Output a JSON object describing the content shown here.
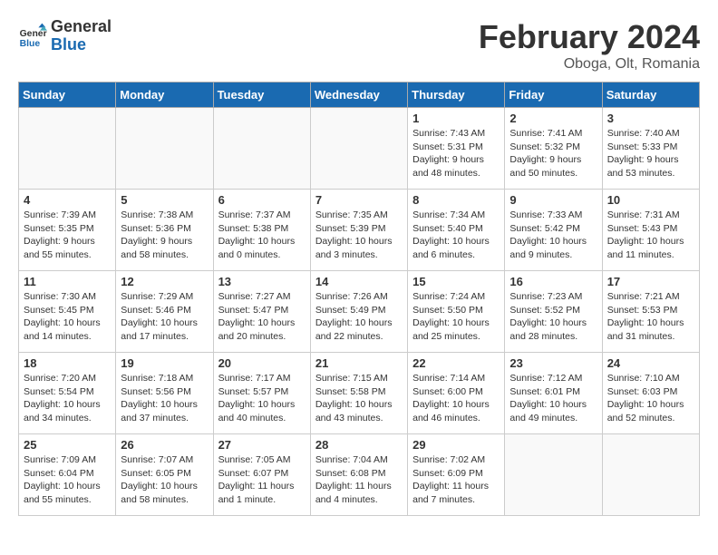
{
  "header": {
    "logo_general": "General",
    "logo_blue": "Blue",
    "month_year": "February 2024",
    "location": "Oboga, Olt, Romania"
  },
  "weekdays": [
    "Sunday",
    "Monday",
    "Tuesday",
    "Wednesday",
    "Thursday",
    "Friday",
    "Saturday"
  ],
  "weeks": [
    [
      {
        "day": "",
        "sunrise": "",
        "sunset": "",
        "daylight": ""
      },
      {
        "day": "",
        "sunrise": "",
        "sunset": "",
        "daylight": ""
      },
      {
        "day": "",
        "sunrise": "",
        "sunset": "",
        "daylight": ""
      },
      {
        "day": "",
        "sunrise": "",
        "sunset": "",
        "daylight": ""
      },
      {
        "day": "1",
        "sunrise": "7:43 AM",
        "sunset": "5:31 PM",
        "daylight": "9 hours and 48 minutes."
      },
      {
        "day": "2",
        "sunrise": "7:41 AM",
        "sunset": "5:32 PM",
        "daylight": "9 hours and 50 minutes."
      },
      {
        "day": "3",
        "sunrise": "7:40 AM",
        "sunset": "5:33 PM",
        "daylight": "9 hours and 53 minutes."
      }
    ],
    [
      {
        "day": "4",
        "sunrise": "7:39 AM",
        "sunset": "5:35 PM",
        "daylight": "9 hours and 55 minutes."
      },
      {
        "day": "5",
        "sunrise": "7:38 AM",
        "sunset": "5:36 PM",
        "daylight": "9 hours and 58 minutes."
      },
      {
        "day": "6",
        "sunrise": "7:37 AM",
        "sunset": "5:38 PM",
        "daylight": "10 hours and 0 minutes."
      },
      {
        "day": "7",
        "sunrise": "7:35 AM",
        "sunset": "5:39 PM",
        "daylight": "10 hours and 3 minutes."
      },
      {
        "day": "8",
        "sunrise": "7:34 AM",
        "sunset": "5:40 PM",
        "daylight": "10 hours and 6 minutes."
      },
      {
        "day": "9",
        "sunrise": "7:33 AM",
        "sunset": "5:42 PM",
        "daylight": "10 hours and 9 minutes."
      },
      {
        "day": "10",
        "sunrise": "7:31 AM",
        "sunset": "5:43 PM",
        "daylight": "10 hours and 11 minutes."
      }
    ],
    [
      {
        "day": "11",
        "sunrise": "7:30 AM",
        "sunset": "5:45 PM",
        "daylight": "10 hours and 14 minutes."
      },
      {
        "day": "12",
        "sunrise": "7:29 AM",
        "sunset": "5:46 PM",
        "daylight": "10 hours and 17 minutes."
      },
      {
        "day": "13",
        "sunrise": "7:27 AM",
        "sunset": "5:47 PM",
        "daylight": "10 hours and 20 minutes."
      },
      {
        "day": "14",
        "sunrise": "7:26 AM",
        "sunset": "5:49 PM",
        "daylight": "10 hours and 22 minutes."
      },
      {
        "day": "15",
        "sunrise": "7:24 AM",
        "sunset": "5:50 PM",
        "daylight": "10 hours and 25 minutes."
      },
      {
        "day": "16",
        "sunrise": "7:23 AM",
        "sunset": "5:52 PM",
        "daylight": "10 hours and 28 minutes."
      },
      {
        "day": "17",
        "sunrise": "7:21 AM",
        "sunset": "5:53 PM",
        "daylight": "10 hours and 31 minutes."
      }
    ],
    [
      {
        "day": "18",
        "sunrise": "7:20 AM",
        "sunset": "5:54 PM",
        "daylight": "10 hours and 34 minutes."
      },
      {
        "day": "19",
        "sunrise": "7:18 AM",
        "sunset": "5:56 PM",
        "daylight": "10 hours and 37 minutes."
      },
      {
        "day": "20",
        "sunrise": "7:17 AM",
        "sunset": "5:57 PM",
        "daylight": "10 hours and 40 minutes."
      },
      {
        "day": "21",
        "sunrise": "7:15 AM",
        "sunset": "5:58 PM",
        "daylight": "10 hours and 43 minutes."
      },
      {
        "day": "22",
        "sunrise": "7:14 AM",
        "sunset": "6:00 PM",
        "daylight": "10 hours and 46 minutes."
      },
      {
        "day": "23",
        "sunrise": "7:12 AM",
        "sunset": "6:01 PM",
        "daylight": "10 hours and 49 minutes."
      },
      {
        "day": "24",
        "sunrise": "7:10 AM",
        "sunset": "6:03 PM",
        "daylight": "10 hours and 52 minutes."
      }
    ],
    [
      {
        "day": "25",
        "sunrise": "7:09 AM",
        "sunset": "6:04 PM",
        "daylight": "10 hours and 55 minutes."
      },
      {
        "day": "26",
        "sunrise": "7:07 AM",
        "sunset": "6:05 PM",
        "daylight": "10 hours and 58 minutes."
      },
      {
        "day": "27",
        "sunrise": "7:05 AM",
        "sunset": "6:07 PM",
        "daylight": "11 hours and 1 minute."
      },
      {
        "day": "28",
        "sunrise": "7:04 AM",
        "sunset": "6:08 PM",
        "daylight": "11 hours and 4 minutes."
      },
      {
        "day": "29",
        "sunrise": "7:02 AM",
        "sunset": "6:09 PM",
        "daylight": "11 hours and 7 minutes."
      },
      {
        "day": "",
        "sunrise": "",
        "sunset": "",
        "daylight": ""
      },
      {
        "day": "",
        "sunrise": "",
        "sunset": "",
        "daylight": ""
      }
    ]
  ],
  "labels": {
    "sunrise": "Sunrise:",
    "sunset": "Sunset:",
    "daylight": "Daylight:"
  }
}
